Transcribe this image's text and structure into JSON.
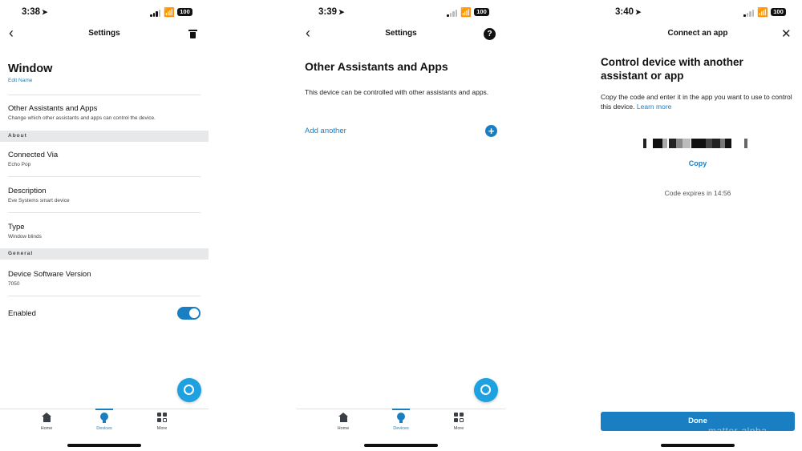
{
  "screen1": {
    "status": {
      "time": "3:38",
      "battery": "100"
    },
    "nav": {
      "title": "Settings"
    },
    "device_name": "Window",
    "edit_name": "Edit Name",
    "other_assistants": {
      "title": "Other Assistants and Apps",
      "subtitle": "Change which other assistants and apps can control the device."
    },
    "section_about": "About",
    "connected_via": {
      "title": "Connected Via",
      "value": "Echo Pop"
    },
    "description": {
      "title": "Description",
      "value": "Eve Systems smart device"
    },
    "type": {
      "title": "Type",
      "value": "Window blinds"
    },
    "section_general": "General",
    "software_version": {
      "title": "Device Software Version",
      "value": "7050"
    },
    "enabled": {
      "label": "Enabled",
      "on": true
    },
    "tabs": [
      "Home",
      "Devices",
      "More"
    ]
  },
  "screen2": {
    "status": {
      "time": "3:39",
      "battery": "100"
    },
    "nav": {
      "title": "Settings"
    },
    "heading": "Other Assistants and Apps",
    "body": "This device can be controlled with other assistants and apps.",
    "add_another": "Add another",
    "tabs": [
      "Home",
      "Devices",
      "More"
    ]
  },
  "screen3": {
    "status": {
      "time": "3:40",
      "battery": "100"
    },
    "nav": {
      "title": "Connect an app"
    },
    "heading": "Control device with another assistant or app",
    "body": "Copy the code and enter it in the app you want to use to control this device.",
    "learn_more": "Learn more",
    "copy": "Copy",
    "expires": "Code expires in 14:56",
    "done": "Done",
    "watermark": "matter-alpha"
  },
  "colors": {
    "accent": "#1a7fc2",
    "alexa": "#1da1e0",
    "band": "#e6e8ea"
  },
  "icons": [
    "back-chevron-icon",
    "trash-icon",
    "help-icon",
    "close-icon",
    "plus-circle-icon",
    "alexa-icon",
    "home-icon",
    "devices-icon",
    "more-icon"
  ]
}
